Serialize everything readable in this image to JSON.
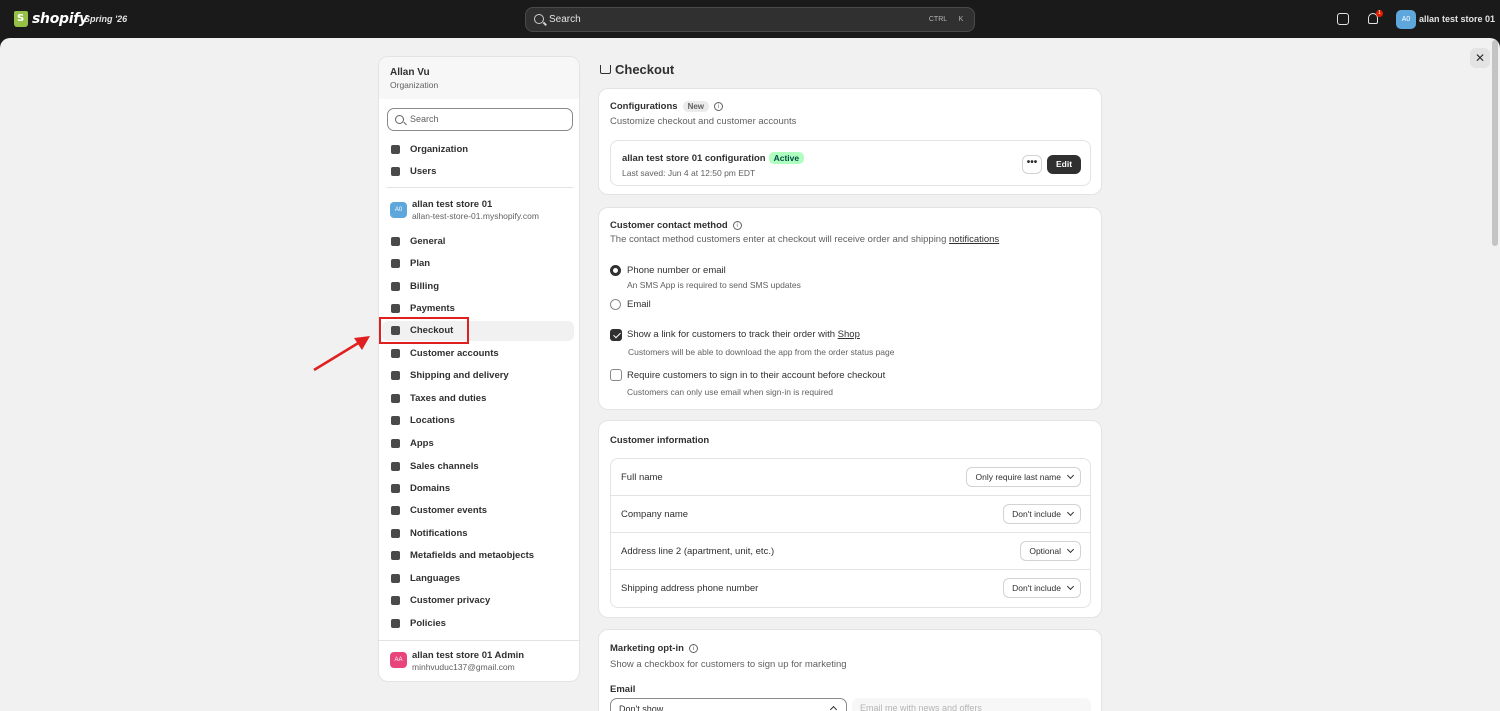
{
  "topbar": {
    "logo_text": "shopify",
    "edition": "Spring '26",
    "search_placeholder": "Search",
    "shortcut_ctrl": "CTRL",
    "shortcut_k": "K",
    "notification_count": "1",
    "store_avatar": "A0",
    "store_name": "allan test store 01"
  },
  "close_label": "✕",
  "sidebar": {
    "org_name": "Allan Vu",
    "org_type": "Organization",
    "search_placeholder": "Search",
    "org_items": [
      {
        "label": "Organization",
        "icon": "building-icon"
      },
      {
        "label": "Users",
        "icon": "users-icon"
      }
    ],
    "store": {
      "avatar": "A0",
      "name": "allan test store 01",
      "url": "allan-test-store-01.myshopify.com"
    },
    "items": [
      {
        "label": "General",
        "icon": "store-icon"
      },
      {
        "label": "Plan",
        "icon": "plan-icon"
      },
      {
        "label": "Billing",
        "icon": "billing-icon"
      },
      {
        "label": "Payments",
        "icon": "payments-icon"
      },
      {
        "label": "Checkout",
        "icon": "cart-icon"
      },
      {
        "label": "Customer accounts",
        "icon": "person-icon"
      },
      {
        "label": "Shipping and delivery",
        "icon": "truck-icon"
      },
      {
        "label": "Taxes and duties",
        "icon": "tax-icon"
      },
      {
        "label": "Locations",
        "icon": "location-icon"
      },
      {
        "label": "Apps",
        "icon": "apps-icon"
      },
      {
        "label": "Sales channels",
        "icon": "channels-icon"
      },
      {
        "label": "Domains",
        "icon": "domains-icon"
      },
      {
        "label": "Customer events",
        "icon": "cursor-icon"
      },
      {
        "label": "Notifications",
        "icon": "bell-icon"
      },
      {
        "label": "Metafields and metaobjects",
        "icon": "metafields-icon"
      },
      {
        "label": "Languages",
        "icon": "language-icon"
      },
      {
        "label": "Customer privacy",
        "icon": "lock-icon"
      },
      {
        "label": "Policies",
        "icon": "policies-icon"
      }
    ],
    "user": {
      "avatar": "AA",
      "name": "allan test store 01 Admin",
      "email": "minhvuduc137@gmail.com"
    }
  },
  "page": {
    "title": "Checkout"
  },
  "configurations": {
    "title": "Configurations",
    "badge": "New",
    "subtitle": "Customize checkout and customer accounts",
    "config_name": "allan test store 01 configuration",
    "status": "Active",
    "last_saved": "Last saved: Jun 4 at 12:50 pm EDT",
    "more_label": "•••",
    "edit_label": "Edit"
  },
  "contact_method": {
    "title": "Customer contact method",
    "subtitle_prefix": "The contact method customers enter at checkout will receive order and shipping ",
    "subtitle_link": "notifications",
    "option_phone": "Phone number or email",
    "option_phone_help": "An SMS App is required to send SMS updates",
    "option_email": "Email",
    "track_link_prefix": "Show a link for customers to track their order with ",
    "track_link_word": "Shop",
    "track_help": "Customers will be able to download the app from the order status page",
    "require_signin": "Require customers to sign in to their account before checkout",
    "require_help": "Customers can only use email when sign-in is required"
  },
  "customer_info": {
    "title": "Customer information",
    "rows": [
      {
        "label": "Full name",
        "value": "Only require last name"
      },
      {
        "label": "Company name",
        "value": "Don't include"
      },
      {
        "label": "Address line 2 (apartment, unit, etc.)",
        "value": "Optional"
      },
      {
        "label": "Shipping address phone number",
        "value": "Don't include"
      }
    ]
  },
  "marketing": {
    "title": "Marketing opt-in",
    "subtitle": "Show a checkbox for customers to sign up for marketing",
    "email_label": "Email",
    "email_select": "Don't show",
    "email_input_placeholder": "Email me with news and offers"
  },
  "colors": {
    "accent_annotation": "#e02020",
    "active_badge": "#affebf",
    "store_avatar": "#5ea7dd",
    "user_avatar": "#e8457c"
  }
}
